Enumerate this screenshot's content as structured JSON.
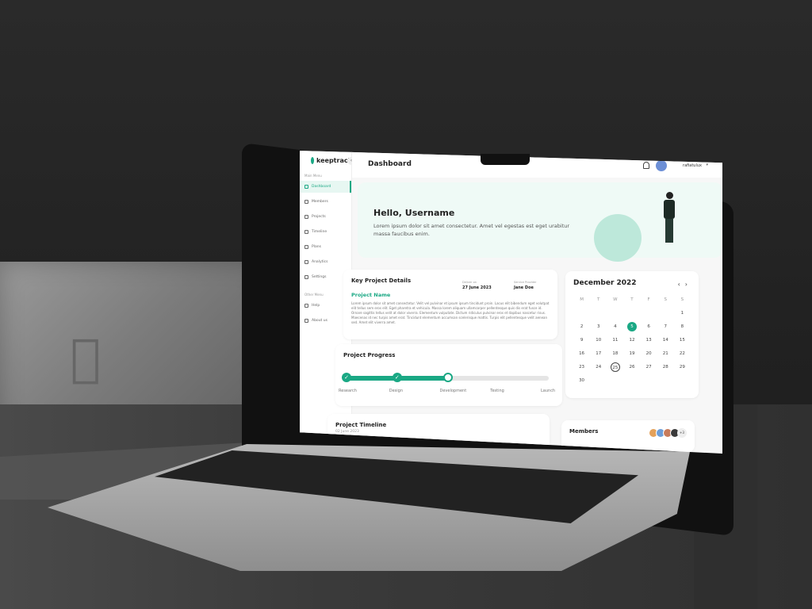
{
  "app": {
    "logo_text": "keeptrack",
    "collapse_icon": "chevron-left-icon"
  },
  "sidebar": {
    "main_menu_label": "Main Menu",
    "other_menu_label": "Other Menu",
    "items": [
      {
        "label": "Dashboard",
        "icon": "grid-icon",
        "active": true
      },
      {
        "label": "Members",
        "icon": "users-icon"
      },
      {
        "label": "Projects",
        "icon": "folder-icon"
      },
      {
        "label": "Timeline",
        "icon": "timeline-icon"
      },
      {
        "label": "Plans",
        "icon": "plan-icon"
      },
      {
        "label": "Analytics",
        "icon": "chart-icon"
      },
      {
        "label": "Settings",
        "icon": "gear-icon"
      }
    ],
    "other_items": [
      {
        "label": "Help",
        "icon": "help-icon"
      },
      {
        "label": "About us",
        "icon": "info-icon"
      }
    ]
  },
  "header": {
    "title": "Dashboard",
    "user_name": "rafiatulux"
  },
  "hero": {
    "title": "Hello, Username",
    "text": "Lorem ipsum dolor sit amet consectetur. Amet vel egestas est eget urabitur massa faucibus enim."
  },
  "key_project": {
    "title": "Key Project Details",
    "project_name": "Project Name",
    "deliver_label": "Deliver on",
    "deliver_date": "27 June 2023",
    "provider_label": "Service Provider",
    "provider_name": "Jane Doe",
    "description": "Lorem ipsum dolor sit amet consectetur. Velit vel pulvinar et ipsum ipsum tincidunt proin. Lacus elit bibendum eget volutpat elit tellus sem eros elit. Eget pharetra et vehicula. Massa lorem aliquam ullamcorper pellentesque quis dis erat fusce id. Ornare sagittis tellus velit at dolor viverra. Elementum vulputate. Dictum ridiculus pulvinar eros et dapibus nascetur risus. Maecenas id nec turpis amet erat. Tincidunt elementum accumsan scelerisque mattis. Turpis elit pellentesque velit aenean sed. Amet elit viverra amet."
  },
  "progress": {
    "title": "Project Progress",
    "stages": [
      "Research",
      "Design",
      "Development",
      "Testing",
      "Launch"
    ],
    "completed": 2,
    "current": 3
  },
  "timeline": {
    "title": "Project Timeline",
    "date": "02 June 2023"
  },
  "calendar": {
    "title": "December 2022",
    "weekdays": [
      "M",
      "T",
      "W",
      "T",
      "F",
      "S",
      "S"
    ],
    "days": [
      "",
      "",
      "",
      "",
      "",
      "",
      "1",
      "2",
      "3",
      "4",
      "5",
      "6",
      "7",
      "8",
      "9",
      "10",
      "11",
      "12",
      "13",
      "14",
      "15",
      "16",
      "17",
      "18",
      "19",
      "20",
      "21",
      "22",
      "23",
      "24",
      "25",
      "26",
      "27",
      "28",
      "29",
      "30"
    ],
    "selected": "5",
    "today": "25"
  },
  "members": {
    "title": "Members",
    "more": "+3",
    "avatar_colors": [
      "#e4a15a",
      "#6d9ed9",
      "#c77b5b",
      "#3a3a3a"
    ]
  },
  "colors": {
    "accent": "#1aa884",
    "hero_bg": "#effaf6"
  }
}
